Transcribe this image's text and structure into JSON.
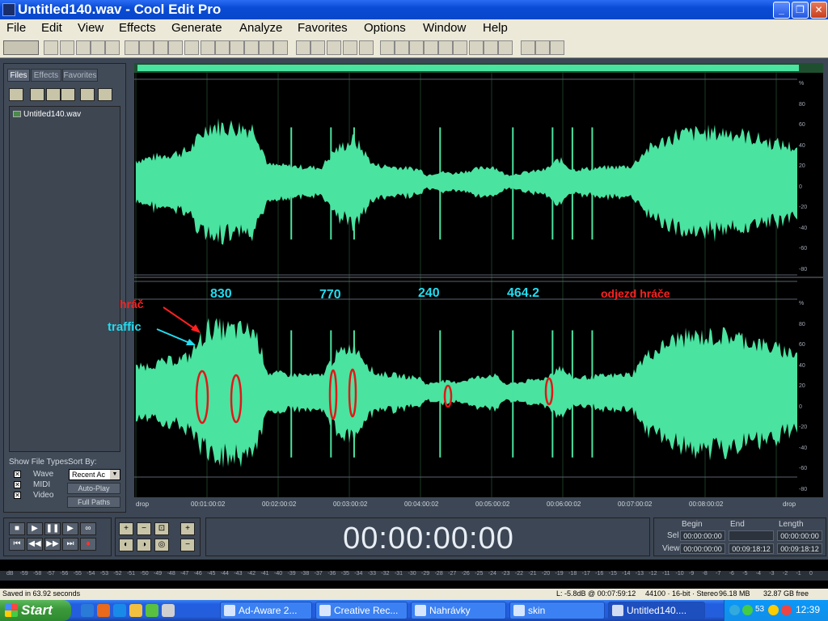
{
  "window": {
    "title": "Untitled140.wav - Cool Edit Pro"
  },
  "menu": [
    "File",
    "Edit",
    "View",
    "Effects",
    "Generate",
    "Analyze",
    "Favorites",
    "Options",
    "Window",
    "Help"
  ],
  "left_panel": {
    "tabs": [
      "Files",
      "Effects",
      "Favorites"
    ],
    "files": [
      "Untitled140.wav"
    ],
    "show_file_types_label": "Show File Types:",
    "sort_by_label": "Sort By:",
    "sort_by_value": "Recent Ac",
    "file_types": [
      "Wave",
      "MIDI",
      "Video"
    ],
    "buttons": [
      "Auto-Play",
      "Full Paths"
    ]
  },
  "waveform": {
    "db_labels": [
      "%",
      "80",
      "60",
      "40",
      "20",
      "0",
      "-20",
      "-40",
      "-60",
      "-80",
      "%"
    ],
    "time_labels": [
      "drop",
      "00:01:00:02",
      "00:02:00:02",
      "00:03:00:02",
      "00:04:00:02",
      "00:05:00:02",
      "00:06:00:02",
      "00:07:00:02",
      "00:08:00:02",
      "drop"
    ],
    "wave_color": "#4ae3a0",
    "annotations": {
      "numbers": [
        "830",
        "770",
        "240",
        "464.2"
      ],
      "odjezd": "odjezd hráče",
      "hrac": "hráč",
      "traffic": "traffic"
    },
    "annotation_colors": {
      "cyan": "#22ddf0",
      "red": "#ff2020"
    }
  },
  "time_display": "00:00:00:00",
  "selection": {
    "headers": [
      "Begin",
      "End",
      "Length"
    ],
    "sel_label": "Sel",
    "view_label": "View",
    "sel": [
      "00:00:00:00",
      "",
      "00:00:00:00"
    ],
    "view": [
      "00:00:00:00",
      "00:09:18:12",
      "00:09:18:12"
    ]
  },
  "meter_labels": [
    "dB",
    "-59",
    "-58",
    "-57",
    "-56",
    "-55",
    "-54",
    "-53",
    "-52",
    "-51",
    "-50",
    "-49",
    "-48",
    "-47",
    "-46",
    "-45",
    "-44",
    "-43",
    "-42",
    "-41",
    "-40",
    "-39",
    "-38",
    "-37",
    "-36",
    "-35",
    "-34",
    "-33",
    "-32",
    "-31",
    "-30",
    "-29",
    "-28",
    "-27",
    "-26",
    "-25",
    "-24",
    "-23",
    "-22",
    "-21",
    "-20",
    "-19",
    "-18",
    "-17",
    "-16",
    "-15",
    "-14",
    "-13",
    "-12",
    "-11",
    "-10",
    "-9",
    "-8",
    "-7",
    "-6",
    "-5",
    "-4",
    "-3",
    "-2",
    "-1",
    "0"
  ],
  "status": {
    "saved": "Saved in 63.92 seconds",
    "level": "L: -5.8dB @ 00:07:59:12",
    "format": "44100 · 16-bit · Stereo",
    "size": "96.18 MB",
    "free": "32.87 GB free"
  },
  "taskbar": {
    "start": "Start",
    "tasks": [
      "Ad-Aware 2...",
      "Creative Rec...",
      "Nahrávky",
      "skin",
      "Untitled140...."
    ],
    "tray_badge": "53",
    "clock": "12:39"
  }
}
